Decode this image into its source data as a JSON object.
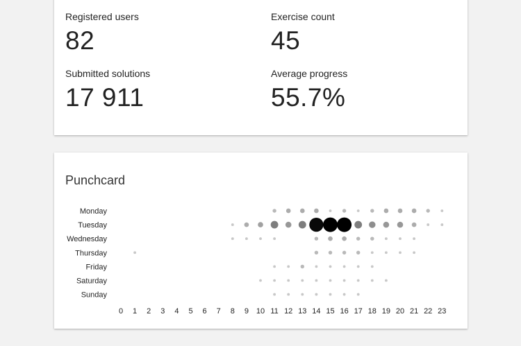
{
  "stats": [
    {
      "label": "Registered users",
      "value": "82"
    },
    {
      "label": "Exercise count",
      "value": "45"
    },
    {
      "label": "Submitted solutions",
      "value": "17 911"
    },
    {
      "label": "Average progress",
      "value": "55.7%"
    }
  ],
  "punchcard": {
    "title": "Punchcard"
  },
  "chart_data": {
    "type": "scatter",
    "title": "Punchcard",
    "days": [
      "Monday",
      "Tuesday",
      "Wednesday",
      "Thursday",
      "Friday",
      "Saturday",
      "Sunday"
    ],
    "hours": [
      "0",
      "1",
      "2",
      "3",
      "4",
      "5",
      "6",
      "7",
      "8",
      "9",
      "10",
      "11",
      "12",
      "13",
      "14",
      "15",
      "16",
      "17",
      "18",
      "19",
      "20",
      "21",
      "22",
      "23"
    ],
    "values": [
      [
        0,
        0,
        0,
        0,
        0,
        0,
        0,
        0,
        0,
        0,
        0,
        2,
        3,
        3,
        3,
        1,
        2,
        1,
        2,
        3,
        3,
        3,
        2,
        1
      ],
      [
        0,
        0,
        0,
        0,
        0,
        0,
        0,
        0,
        1,
        3,
        4,
        8,
        5,
        8,
        28,
        30,
        30,
        8,
        6,
        5,
        5,
        3,
        1,
        1
      ],
      [
        0,
        0,
        0,
        0,
        0,
        0,
        0,
        0,
        1,
        1,
        1,
        1,
        0,
        0,
        2,
        3,
        3,
        2,
        2,
        1,
        1,
        1,
        0,
        0
      ],
      [
        0,
        1,
        0,
        0,
        0,
        0,
        0,
        0,
        0,
        0,
        0,
        0,
        0,
        0,
        2,
        2,
        2,
        2,
        1,
        1,
        1,
        1,
        0,
        0
      ],
      [
        0,
        0,
        0,
        0,
        0,
        0,
        0,
        0,
        0,
        0,
        0,
        1,
        1,
        2,
        1,
        1,
        1,
        1,
        1,
        0,
        0,
        0,
        0,
        0
      ],
      [
        0,
        0,
        0,
        0,
        0,
        0,
        0,
        0,
        0,
        0,
        1,
        1,
        1,
        1,
        1,
        1,
        1,
        1,
        1,
        1,
        0,
        0,
        0,
        0
      ],
      [
        0,
        0,
        0,
        0,
        0,
        0,
        0,
        0,
        0,
        0,
        0,
        1,
        1,
        1,
        1,
        1,
        1,
        1,
        0,
        0,
        0,
        0,
        0,
        0
      ]
    ],
    "max_value": 30,
    "colors": {
      "dot_min": "#e6e6e6",
      "dot_max": "#000000"
    }
  }
}
